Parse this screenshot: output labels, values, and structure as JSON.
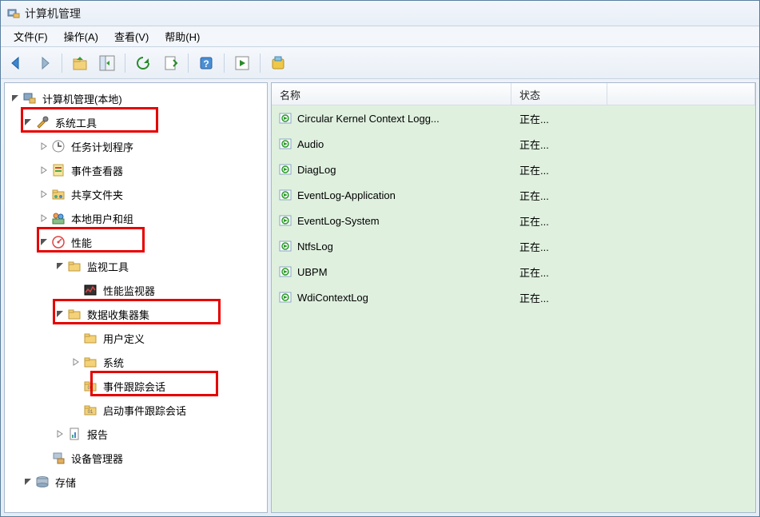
{
  "window": {
    "title": "计算机管理"
  },
  "menubar": {
    "file": "文件(F)",
    "action": "操作(A)",
    "view": "查看(V)",
    "help": "帮助(H)"
  },
  "tree": {
    "root": "计算机管理(本地)",
    "systools": "系统工具",
    "scheduler": "任务计划程序",
    "eventviewer": "事件查看器",
    "shared": "共享文件夹",
    "localusers": "本地用户和组",
    "performance": "性能",
    "monitor_tools": "监视工具",
    "perf_monitor": "性能监视器",
    "collector_sets": "数据收集器集",
    "user_defined": "用户定义",
    "system": "系统",
    "event_trace_sessions": "事件跟踪会话",
    "startup_event_trace": "启动事件跟踪会话",
    "reports": "报告",
    "devicemgr": "设备管理器",
    "storage": "存储"
  },
  "list": {
    "header_name": "名称",
    "header_status": "状态",
    "rows": [
      {
        "name": "Circular Kernel Context Logg...",
        "status": "正在..."
      },
      {
        "name": "Audio",
        "status": "正在..."
      },
      {
        "name": "DiagLog",
        "status": "正在..."
      },
      {
        "name": "EventLog-Application",
        "status": "正在..."
      },
      {
        "name": "EventLog-System",
        "status": "正在..."
      },
      {
        "name": "NtfsLog",
        "status": "正在..."
      },
      {
        "name": "UBPM",
        "status": "正在..."
      },
      {
        "name": "WdiContextLog",
        "status": "正在..."
      }
    ]
  }
}
